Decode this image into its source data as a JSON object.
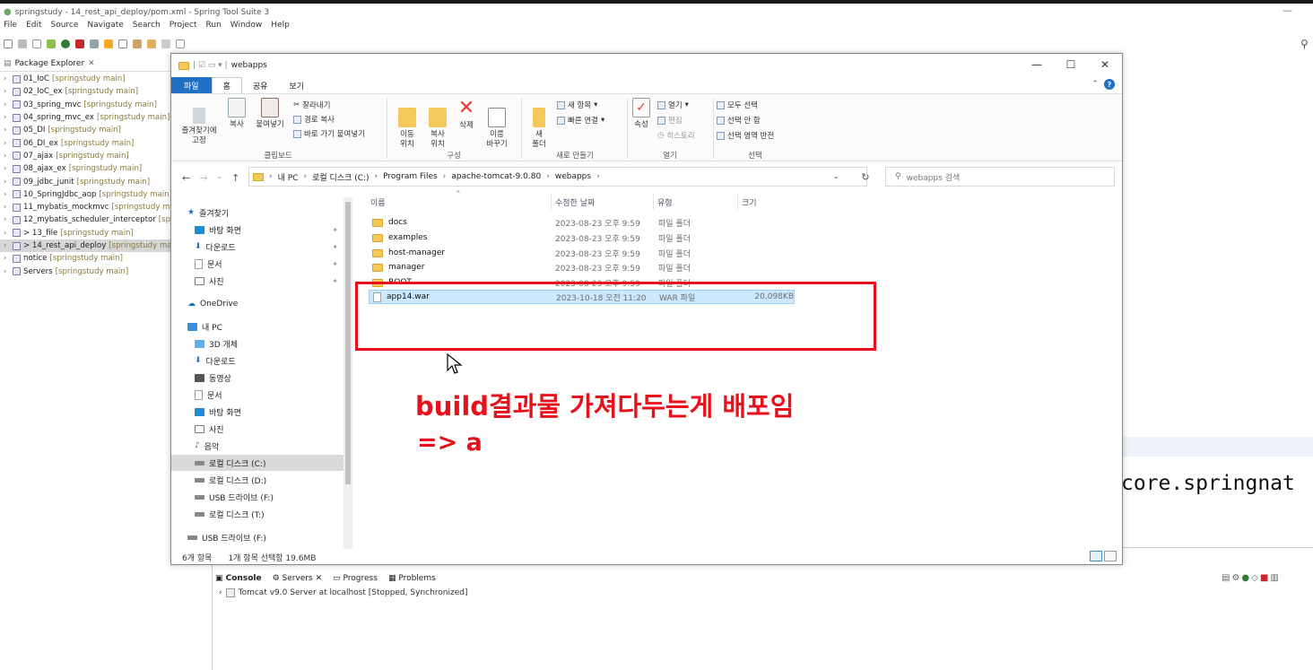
{
  "eclipse": {
    "title": "springstudy - 14_rest_api_deploy/pom.xml - Spring Tool Suite 3",
    "menu": [
      "File",
      "Edit",
      "Source",
      "Navigate",
      "Search",
      "Project",
      "Run",
      "Window",
      "Help"
    ],
    "package_explorer_title": "Package Explorer",
    "projects": [
      {
        "name": "01_IoC",
        "suffix": "[springstudy main]"
      },
      {
        "name": "02_IoC_ex",
        "suffix": "[springstudy main]"
      },
      {
        "name": "03_spring_mvc",
        "suffix": "[springstudy main]"
      },
      {
        "name": "04_spring_mvc_ex",
        "suffix": "[springstudy main]"
      },
      {
        "name": "05_DI",
        "suffix": "[springstudy main]"
      },
      {
        "name": "06_DI_ex",
        "suffix": "[springstudy main]"
      },
      {
        "name": "07_ajax",
        "suffix": "[springstudy main]"
      },
      {
        "name": "08_ajax_ex",
        "suffix": "[springstudy main]"
      },
      {
        "name": "09_jdbc_junit",
        "suffix": "[springstudy main]"
      },
      {
        "name": "10_SpringJdbc_aop",
        "suffix": "[springstudy main]"
      },
      {
        "name": "11_mybatis_mockmvc",
        "suffix": "[springstudy m"
      },
      {
        "name": "12_mybatis_scheduler_interceptor",
        "suffix": "[sp"
      },
      {
        "name": "> 13_file",
        "suffix": "[springstudy main]"
      },
      {
        "name": "> 14_rest_api_deploy",
        "suffix": "[springstudy ma"
      },
      {
        "name": "notice",
        "suffix": "[springstudy main]"
      },
      {
        "name": "Servers",
        "suffix": "[springstudy main]"
      }
    ],
    "console_snippet": "core.springnat",
    "console_tabs": [
      "Console",
      "Servers",
      "Progress",
      "Problems"
    ],
    "server_row": "Tomcat v9.0 Server at localhost  [Stopped, Synchronized]"
  },
  "explorer": {
    "title": "webapps",
    "ribbon_tabs": [
      "파일",
      "홈",
      "공유",
      "보기"
    ],
    "clipboard": {
      "pin": "즐겨찾기에\n고정",
      "copy": "복사",
      "paste": "붙여넣기",
      "cut": "잘라내기",
      "copy_path": "경로 복사",
      "paste_shortcut": "바로 가기 붙여넣기",
      "label": "클립보드"
    },
    "organize": {
      "move": "이동\n위치",
      "copy_to": "복사\n위치",
      "delete": "삭제",
      "rename": "이름\n바꾸기",
      "label": "구성"
    },
    "new": {
      "new_folder": "새\n폴더",
      "new_item": "새 항목",
      "easy_access": "빠른 연결",
      "label": "새로 만들기"
    },
    "open": {
      "properties": "속성",
      "open": "열기",
      "edit": "편집",
      "history": "히스토리",
      "label": "열기"
    },
    "select": {
      "select_all": "모두 선택",
      "select_none": "선택 안 함",
      "invert": "선택 영역 반전",
      "label": "선택"
    },
    "breadcrumbs": [
      "내 PC",
      "로컬 디스크 (C:)",
      "Program Files",
      "apache-tomcat-9.0.80",
      "webapps"
    ],
    "search_placeholder": "webapps 검색",
    "nav": [
      {
        "label": "즐겨찾기",
        "icon": "star-icon"
      },
      {
        "label": "바탕 화면",
        "icon": "desktop-icon",
        "pinned": true
      },
      {
        "label": "다운로드",
        "icon": "download-icon",
        "pinned": true
      },
      {
        "label": "문서",
        "icon": "document-icon",
        "pinned": true
      },
      {
        "label": "사진",
        "icon": "picture-icon",
        "pinned": true
      },
      {
        "label": "OneDrive",
        "icon": "cloud-icon"
      },
      {
        "label": "내 PC",
        "icon": "pc-icon"
      },
      {
        "label": "3D 개체",
        "icon": "cube-icon"
      },
      {
        "label": "다운로드",
        "icon": "download-icon"
      },
      {
        "label": "동영상",
        "icon": "video-icon"
      },
      {
        "label": "문서",
        "icon": "document-icon"
      },
      {
        "label": "바탕 화면",
        "icon": "desktop-icon"
      },
      {
        "label": "사진",
        "icon": "picture-icon"
      },
      {
        "label": "음악",
        "icon": "music-icon"
      },
      {
        "label": "로컬 디스크 (C:)",
        "icon": "drive-icon"
      },
      {
        "label": "로컬 디스크 (D:)",
        "icon": "drive-icon"
      },
      {
        "label": "USB 드라이브 (F:)",
        "icon": "usb-icon"
      },
      {
        "label": "로컬 디스크 (T:)",
        "icon": "drive-icon"
      },
      {
        "label": "USB 드라이브 (F:)",
        "icon": "usb-icon"
      }
    ],
    "columns": [
      "이름",
      "수정한 날짜",
      "유형",
      "크기"
    ],
    "files": [
      {
        "name": "docs",
        "date": "2023-08-23 오후 9:59",
        "type": "파일 폴더",
        "size": "",
        "kind": "folder"
      },
      {
        "name": "examples",
        "date": "2023-08-23 오후 9:59",
        "type": "파일 폴더",
        "size": "",
        "kind": "folder"
      },
      {
        "name": "host-manager",
        "date": "2023-08-23 오후 9:59",
        "type": "파일 폴더",
        "size": "",
        "kind": "folder"
      },
      {
        "name": "manager",
        "date": "2023-08-23 오후 9:59",
        "type": "파일 폴더",
        "size": "",
        "kind": "folder"
      },
      {
        "name": "ROOT",
        "date": "2023-08-23 오후 9:59",
        "type": "파일 폴더",
        "size": "",
        "kind": "folder"
      },
      {
        "name": "app14.war",
        "date": "2023-10-18 오전 11:20",
        "type": "WAR 파일",
        "size": "20,098KB",
        "kind": "file"
      }
    ],
    "status_count": "6개 항목",
    "status_selected": "1개 항목 선택함 19.6MB"
  },
  "annotation": {
    "line1": "build결과물 가져다두는게 배포임",
    "line2": "=>  a",
    "color": "#e8101a"
  }
}
